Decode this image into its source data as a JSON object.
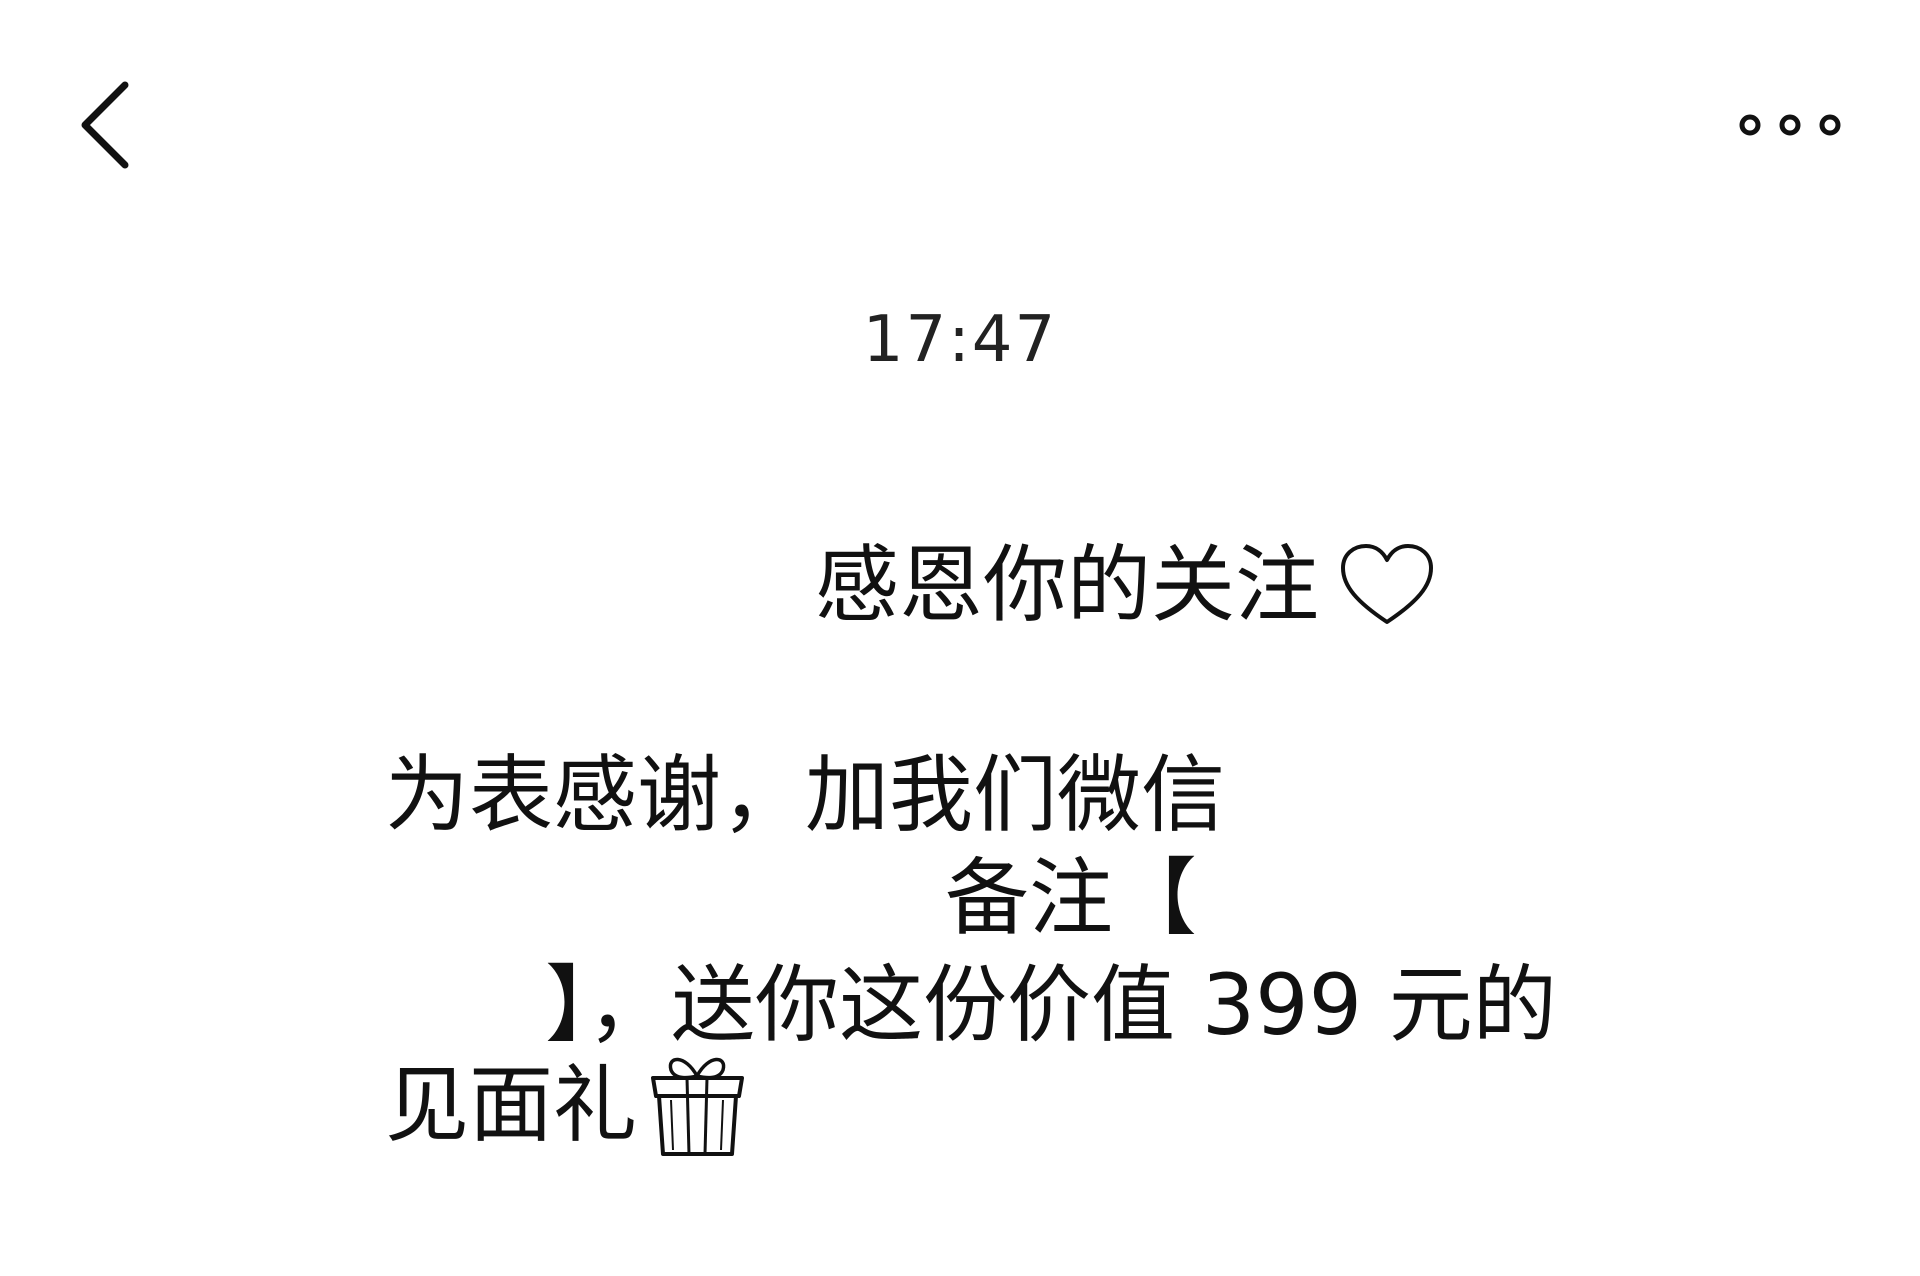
{
  "top_bar": {
    "back_icon": "chevron-left-icon",
    "more_icon": "more-dots-icon"
  },
  "chat": {
    "timestamp": "17:47",
    "message": {
      "line1": "感恩你的关注",
      "line1_icon": "heart-icon",
      "line2": "为表感谢，加我们微信",
      "line3": "备注【",
      "line4": "】，送你这份价值 399 元的",
      "line5": "见面礼",
      "line5_icon": "gift-icon"
    }
  },
  "colors": {
    "background": "#ffffff",
    "text": "#111111"
  }
}
